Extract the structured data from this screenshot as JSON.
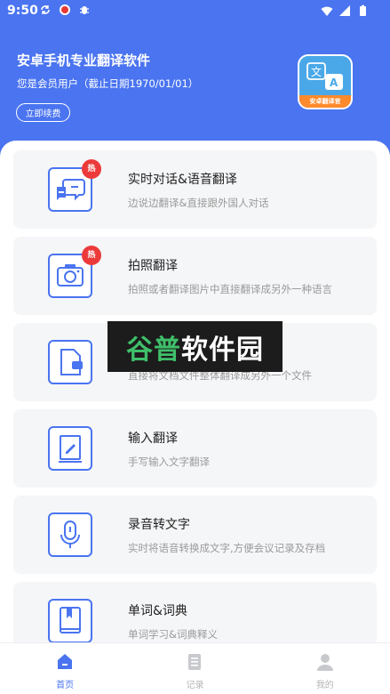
{
  "status_bar": {
    "time": "9:50"
  },
  "header": {
    "title": "安卓手机专业翻译软件",
    "member_text": "您是会员用户（截止日期1970/01/01）",
    "renew_label": "立即续费",
    "logo_banner": "安卓翻译官",
    "logo_glyph_left": "文",
    "logo_glyph_right": "A"
  },
  "features": [
    {
      "title": "实时对话&语音翻译",
      "desc": "边说边翻译&直接跟外国人对话",
      "badge": "热",
      "icon": "chat-bubbles-icon"
    },
    {
      "title": "拍照翻译",
      "desc": "拍照或者翻译图片中直接翻译成另外一种语言",
      "badge": "热",
      "icon": "camera-icon"
    },
    {
      "title": "",
      "desc": "直接将文档文件整体翻译成另外一个文件",
      "icon": "document-icon"
    },
    {
      "title": "输入翻译",
      "desc": "手写输入文字翻译",
      "icon": "pen-book-icon"
    },
    {
      "title": "录音转文字",
      "desc": "实时将语音转换成文字,方便会议记录及存档",
      "icon": "microphone-icon"
    },
    {
      "title": "单词&词典",
      "desc": "单词学习&词典释义",
      "icon": "bookmark-book-icon"
    }
  ],
  "watermark": {
    "first": "谷普",
    "rest": "软件园"
  },
  "nav": [
    {
      "label": "首页",
      "icon": "home-icon",
      "active": true
    },
    {
      "label": "记录",
      "icon": "records-icon",
      "active": false
    },
    {
      "label": "我的",
      "icon": "profile-icon",
      "active": false
    }
  ],
  "colors": {
    "primary": "#4a74f0",
    "hot": "#ec3a3a",
    "card_bg": "#f5f6f8"
  }
}
